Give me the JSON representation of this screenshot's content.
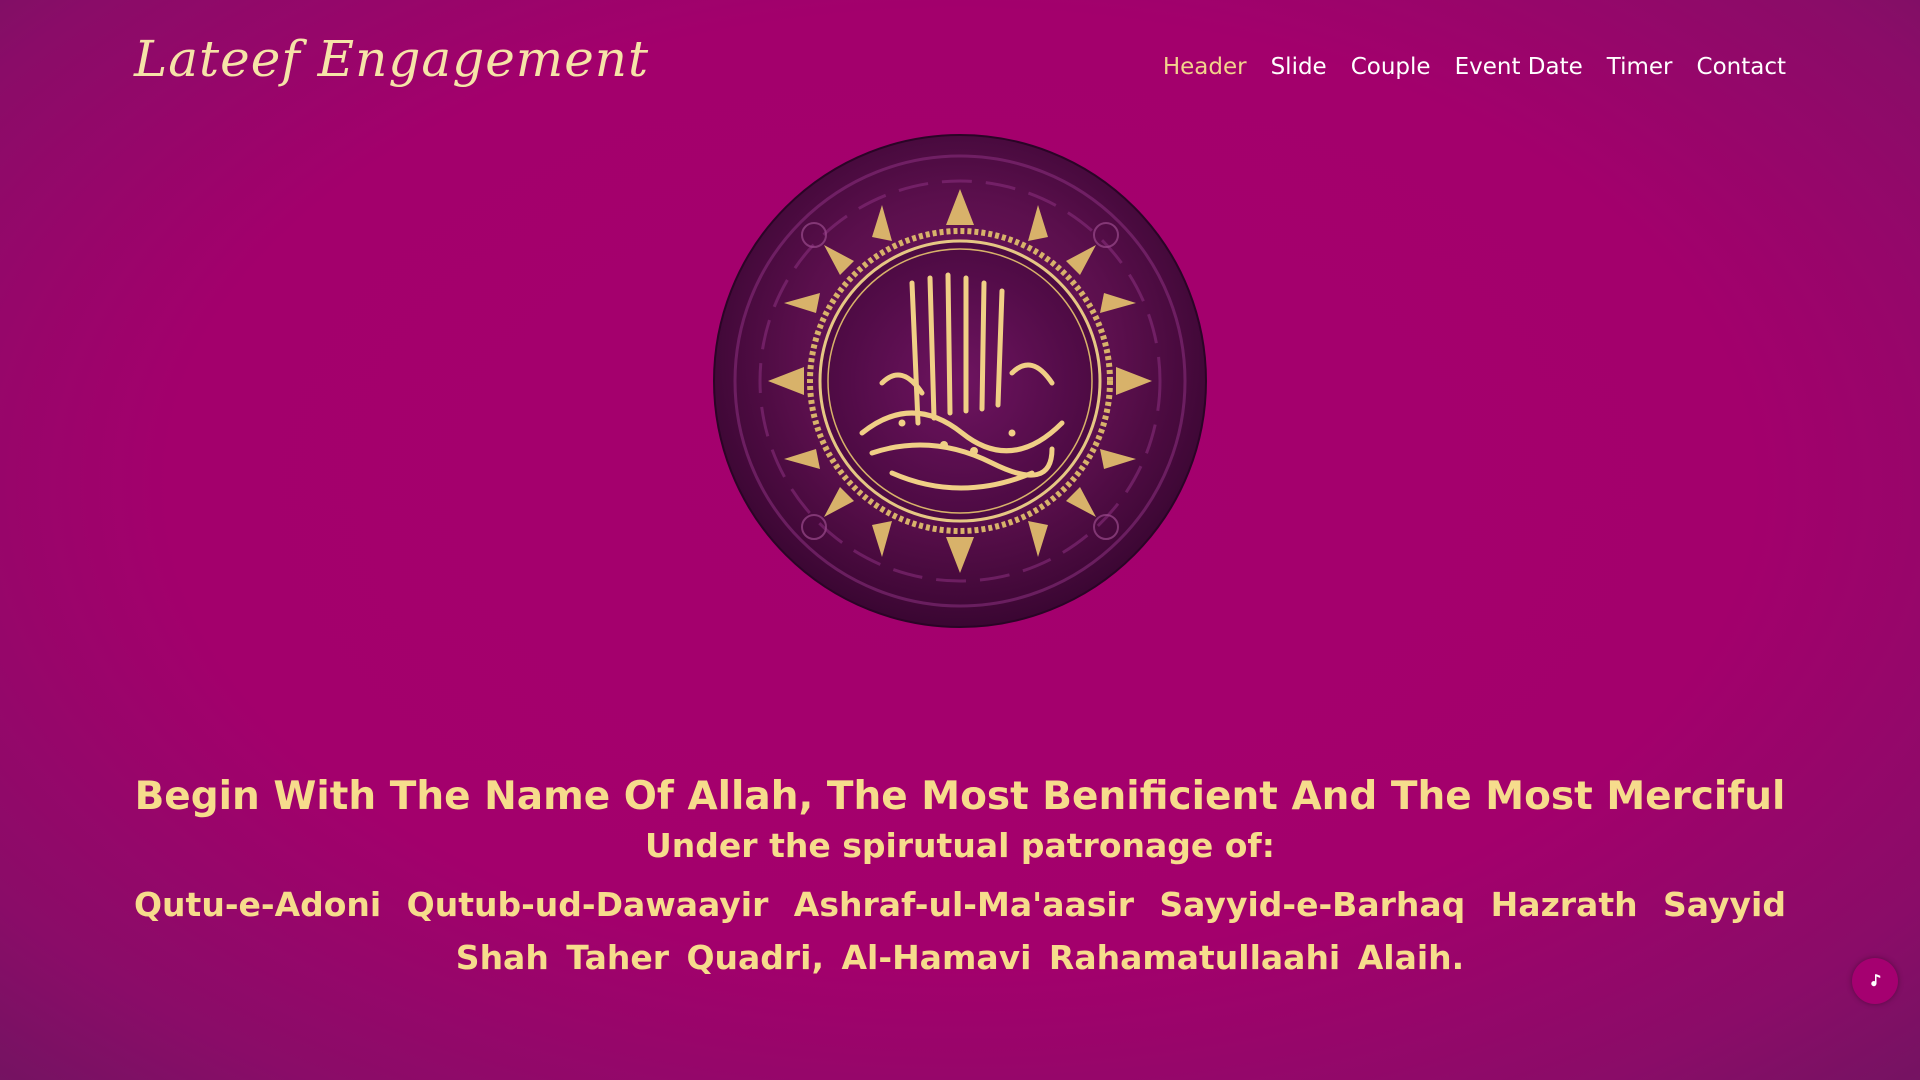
{
  "brand": {
    "name": "Lateef Engagement"
  },
  "nav": {
    "items": [
      {
        "label": "Header",
        "active": true
      },
      {
        "label": "Slide",
        "active": false
      },
      {
        "label": "Couple",
        "active": false
      },
      {
        "label": "Event Date",
        "active": false
      },
      {
        "label": "Timer",
        "active": false
      },
      {
        "label": "Contact",
        "active": false
      }
    ]
  },
  "hero": {
    "emblem_icon": "bismillah-calligraphy-medallion",
    "headline": "Begin With The Name Of Allah, The Most Benificient And The Most Merciful",
    "patron_label": "Under the spirutual patronage of:",
    "patron_names": "Qutu-e-Adoni  Qutub-ud-Dawaayir  Ashraf-ul-Ma'aasir  Sayyid-e-Barhaq  Hazrath  Sayyid  Shah  Taher Quadri, Al-Hamavi Rahamatullaahi Alaih."
  },
  "music_button": {
    "icon": "music-note-icon"
  },
  "colors": {
    "background": "#a3006c",
    "gold": "#f6dc8c",
    "nav_active": "#f3d38c",
    "nav_text": "#ffffff",
    "medallion": "#4a0a3e"
  }
}
